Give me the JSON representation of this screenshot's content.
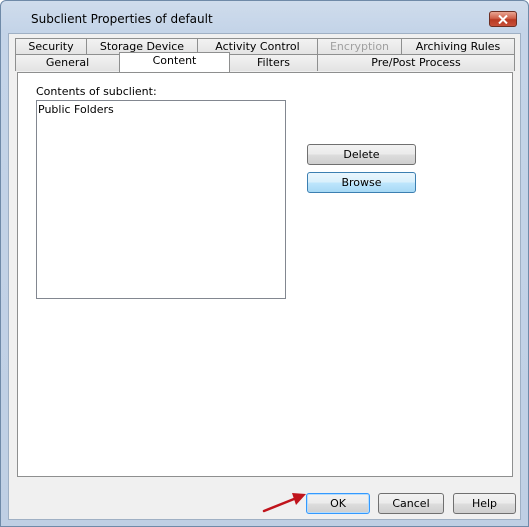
{
  "window": {
    "title": "Subclient Properties of default"
  },
  "tabs_back": [
    {
      "label": "Security",
      "disabled": false
    },
    {
      "label": "Storage Device",
      "disabled": false
    },
    {
      "label": "Activity Control",
      "disabled": false
    },
    {
      "label": "Encryption",
      "disabled": true
    },
    {
      "label": "Archiving Rules",
      "disabled": false
    }
  ],
  "tabs_front": [
    {
      "label": "General",
      "active": false
    },
    {
      "label": "Content",
      "active": true
    },
    {
      "label": "Filters",
      "active": false
    },
    {
      "label": "Pre/Post Process",
      "active": false
    }
  ],
  "content": {
    "label": "Contents of subclient:",
    "items": [
      "Public Folders"
    ],
    "delete_label": "Delete",
    "browse_label": "Browse"
  },
  "footer": {
    "ok_label": "OK",
    "cancel_label": "Cancel",
    "help_label": "Help"
  },
  "colors": {
    "pointer_arrow": "#c0141c",
    "accent": "#3399ff"
  }
}
